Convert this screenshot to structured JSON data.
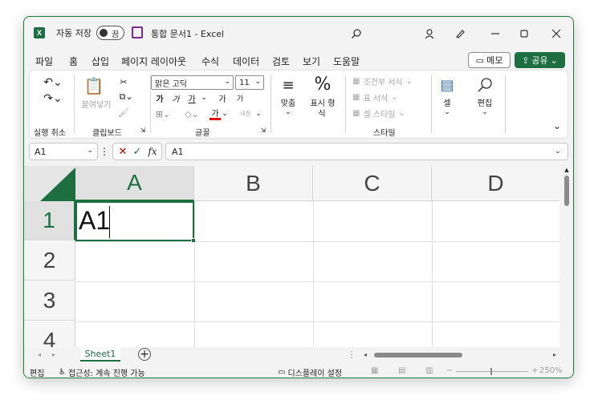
{
  "titlebar": {
    "logo_letter": "X",
    "autosave_label": "자동 저장",
    "toggle_label": "끔",
    "doc_title": "통합 문서1  -  Excel",
    "search_icon": "search-icon",
    "user_icon": "person-icon",
    "pen_icon": "pen-icon"
  },
  "menu": {
    "items": [
      "파일",
      "홈",
      "삽입",
      "페이지 레이아웃",
      "수식",
      "데이터",
      "검토",
      "보기",
      "도움말"
    ],
    "active": "홈",
    "memo_label": "메모",
    "share_label": "공유"
  },
  "ribbon": {
    "undo_group_label": "실행 취소",
    "paste_label": "붙여넣기",
    "clipboard_label": "클립보드",
    "font_name": "맑은 고딕",
    "font_size": "11",
    "font_group_label": "글꼴",
    "bold": "가",
    "italic": "가",
    "underline": "가",
    "grow_font": "가",
    "shrink_font": "가",
    "font_color": "가",
    "phonetic": "내천",
    "align_label": "맞춤",
    "number_label_1": "표시 형",
    "number_label_2": "식",
    "cond_format": "조건부 서식",
    "table_format": "표 서식",
    "cell_style": "셀 스타일",
    "style_group_label": "스타일",
    "cells_label": "셀",
    "edit_label": "편집"
  },
  "formula_bar": {
    "name_box": "A1",
    "formula": "A1",
    "fx": "fx"
  },
  "grid": {
    "columns": [
      "A",
      "B",
      "C",
      "D"
    ],
    "rows": [
      "1",
      "2",
      "3",
      "4"
    ],
    "active_cell_value": "A1"
  },
  "sheet_tabs": {
    "tabs": [
      "Sheet1"
    ],
    "add": "+"
  },
  "status": {
    "mode": "편집",
    "accessibility": "접근성: 계속 진행 가능",
    "display_settings": "디스플레이 설정",
    "zoom": "250%"
  },
  "colors": {
    "accent": "#1d6f42"
  }
}
